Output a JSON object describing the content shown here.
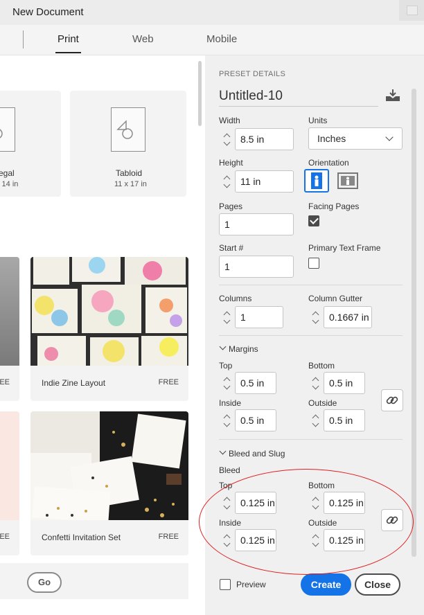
{
  "window": {
    "title": "New Document"
  },
  "tabs": [
    {
      "label": "Print",
      "active": true
    },
    {
      "label": "Web",
      "active": false
    },
    {
      "label": "Mobile",
      "active": false
    }
  ],
  "presets": {
    "blank": [
      {
        "name": "egal",
        "dims": "x 14 in"
      },
      {
        "name": "Tabloid",
        "dims": "11 x 17 in"
      }
    ],
    "templates": [
      {
        "name": "",
        "badge": "REE"
      },
      {
        "name": "Indie Zine Layout",
        "badge": "FREE"
      },
      {
        "name": "",
        "badge": "REE"
      },
      {
        "name": "Confetti Invitation Set",
        "badge": "FREE"
      }
    ],
    "go_label": "Go"
  },
  "details": {
    "header": "PRESET DETAILS",
    "doc_name": "Untitled-10",
    "width": {
      "label": "Width",
      "value": "8.5 in"
    },
    "units": {
      "label": "Units",
      "value": "Inches"
    },
    "height": {
      "label": "Height",
      "value": "11 in"
    },
    "orientation": {
      "label": "Orientation",
      "selected": "portrait"
    },
    "pages": {
      "label": "Pages",
      "value": "1"
    },
    "facing_pages": {
      "label": "Facing Pages",
      "checked": true
    },
    "start": {
      "label": "Start #",
      "value": "1"
    },
    "primary_text_frame": {
      "label": "Primary Text Frame",
      "checked": false
    },
    "columns": {
      "label": "Columns",
      "value": "1"
    },
    "column_gutter": {
      "label": "Column Gutter",
      "value": "0.1667 in"
    },
    "margins": {
      "label": "Margins",
      "top": {
        "label": "Top",
        "value": "0.5 in"
      },
      "bottom": {
        "label": "Bottom",
        "value": "0.5 in"
      },
      "inside": {
        "label": "Inside",
        "value": "0.5 in"
      },
      "outside": {
        "label": "Outside",
        "value": "0.5 in"
      }
    },
    "bleed_slug": {
      "label": "Bleed and Slug",
      "bleed_label": "Bleed",
      "top": {
        "label": "Top",
        "value": "0.125 in"
      },
      "bottom": {
        "label": "Bottom",
        "value": "0.125 in"
      },
      "inside": {
        "label": "Inside",
        "value": "0.125 in"
      },
      "outside": {
        "label": "Outside",
        "value": "0.125 in"
      }
    }
  },
  "footer": {
    "preview": {
      "label": "Preview",
      "checked": false
    },
    "create_label": "Create",
    "close_label": "Close"
  },
  "colors": {
    "accent": "#1473e6",
    "annotation": "#e01e1e"
  }
}
